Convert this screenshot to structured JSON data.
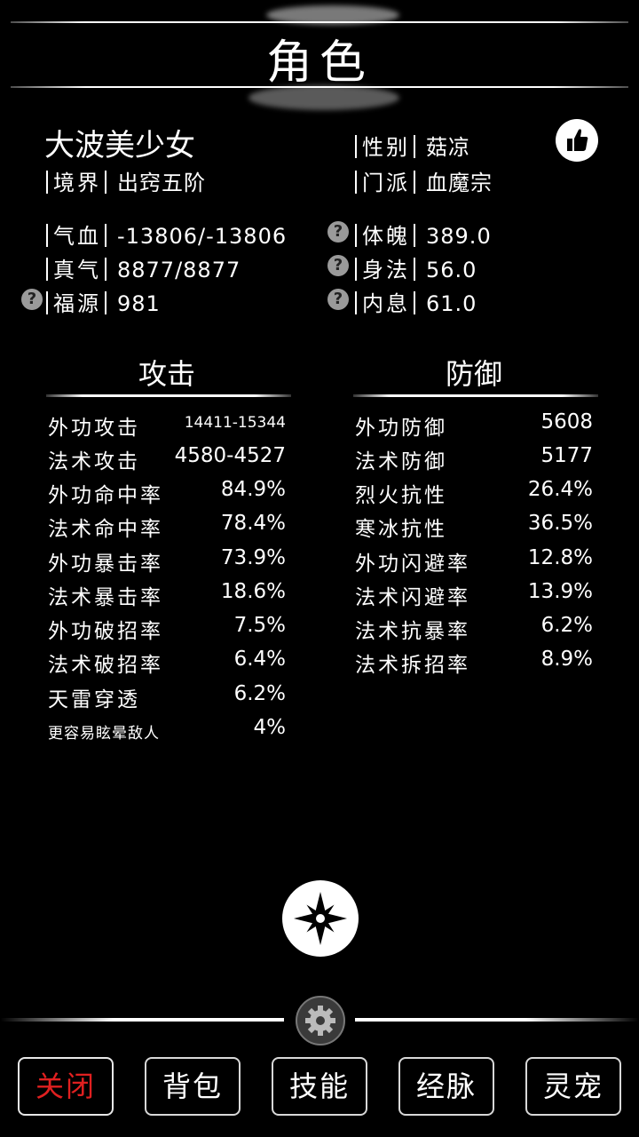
{
  "header": {
    "title": "角色"
  },
  "profile": {
    "name": "大波美少女",
    "realm_label": "境界",
    "realm": "出窍五阶",
    "gender_label": "性别",
    "gender": "菇凉",
    "sect_label": "门派",
    "sect": "血魔宗"
  },
  "attributes": {
    "hp_label": "气血",
    "hp": "-13806/-13806",
    "mp_label": "真气",
    "mp": "8877/8877",
    "luck_label": "福源",
    "luck": "981",
    "physique_label": "体魄",
    "physique": "389.0",
    "agility_label": "身法",
    "agility": "56.0",
    "breath_label": "内息",
    "breath": "61.0",
    "help_glyph": "?"
  },
  "attack": {
    "title": "攻击",
    "stats": [
      {
        "label": "外功攻击",
        "value": "14411-15344"
      },
      {
        "label": "法术攻击",
        "value": "4580-4527"
      },
      {
        "label": "外功命中率",
        "value": "84.9%"
      },
      {
        "label": "法术命中率",
        "value": "78.4%"
      },
      {
        "label": "外功暴击率",
        "value": "73.9%"
      },
      {
        "label": "法术暴击率",
        "value": "18.6%"
      },
      {
        "label": "外功破招率",
        "value": "7.5%"
      },
      {
        "label": "法术破招率",
        "value": "6.4%"
      },
      {
        "label": "天雷穿透",
        "value": "6.2%"
      },
      {
        "label": "更容易眩晕敌人",
        "value": "4%"
      }
    ]
  },
  "defense": {
    "title": "防御",
    "stats": [
      {
        "label": "外功防御",
        "value": "5608"
      },
      {
        "label": "法术防御",
        "value": "5177"
      },
      {
        "label": "烈火抗性",
        "value": "26.4%"
      },
      {
        "label": "寒冰抗性",
        "value": "36.5%"
      },
      {
        "label": "外功闪避率",
        "value": "12.8%"
      },
      {
        "label": "法术闪避率",
        "value": "13.9%"
      },
      {
        "label": "法术抗暴率",
        "value": "6.2%"
      },
      {
        "label": "法术拆招率",
        "value": "8.9%"
      }
    ]
  },
  "icons": {
    "like": "thumbs-up-icon",
    "star": "shuriken-icon",
    "gear": "gear-icon"
  },
  "tabs": [
    {
      "label": "关闭",
      "active": true
    },
    {
      "label": "背包"
    },
    {
      "label": "技能"
    },
    {
      "label": "经脉"
    },
    {
      "label": "灵宠"
    }
  ],
  "colors": {
    "background": "#000000",
    "text": "#ffffff",
    "active_tab": "#e02020",
    "help_icon": "#9a9a9a"
  }
}
